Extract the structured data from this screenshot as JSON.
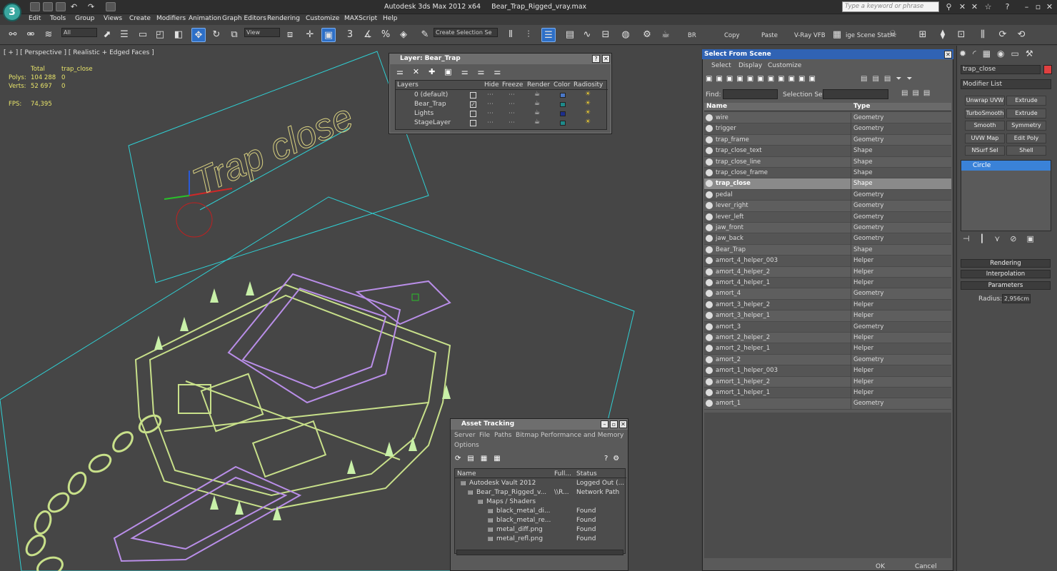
{
  "app": {
    "title": "Autodesk 3ds Max  2012 x64",
    "file": "Bear_Trap_Rigged_vray.max",
    "search_placeholder": "Type a keyword or phrase",
    "logo": "3ds-max-logo"
  },
  "menu": [
    "Edit",
    "Tools",
    "Group",
    "Views",
    "Create",
    "Modifiers",
    "Animation",
    "Graph Editors",
    "Rendering",
    "Customize",
    "MAXScript",
    "Help"
  ],
  "toolbar": {
    "filter": "All",
    "coord": "View",
    "selection_set": "Create Selection Se",
    "br": "BR",
    "copy": "Copy",
    "paste": "Paste",
    "vrayvfb": "V-Ray VFB",
    "scene_state": "ige Scene Stat",
    "snap3": "3",
    "angle_pct": "%"
  },
  "viewport": {
    "label": "[ + ] [ Perspective ] [ Realistic + Edged Faces ]",
    "stats": {
      "col_total": "Total",
      "col_sel": "trap_close",
      "polys_label": "Polys:",
      "polys_total": "104 288",
      "polys_sel": "0",
      "verts_label": "Verts:",
      "verts_total": "52 697",
      "verts_sel": "0",
      "fps_label": "FPS:",
      "fps": "74,395"
    },
    "scene_text": "Trap close"
  },
  "layer_dialog": {
    "title": "Layer: Bear_Trap",
    "columns": [
      "Layers",
      "Hide",
      "Freeze",
      "Render",
      "Color",
      "Radiosity"
    ],
    "rows": [
      {
        "name": "0 (default)",
        "color": "#4a78c8",
        "active": false
      },
      {
        "name": "Bear_Trap",
        "color": "#1e8a8a",
        "active": true
      },
      {
        "name": "Lights",
        "color": "#1c2e8c",
        "active": false
      },
      {
        "name": "StageLayer",
        "color": "#1e8a8a",
        "active": false
      }
    ]
  },
  "select_from_scene": {
    "title": "Select From Scene",
    "menu": [
      "Select",
      "Display",
      "Customize"
    ],
    "find_label": "Find:",
    "selset_label": "Selection Set:",
    "col_name": "Name",
    "col_type": "Type",
    "rows": [
      {
        "name": "wire",
        "type": "Geometry"
      },
      {
        "name": "trigger",
        "type": "Geometry"
      },
      {
        "name": "trap_frame",
        "type": "Geometry"
      },
      {
        "name": "trap_close_text",
        "type": "Shape"
      },
      {
        "name": "trap_close_line",
        "type": "Shape"
      },
      {
        "name": "trap_close_frame",
        "type": "Shape"
      },
      {
        "name": "trap_close",
        "type": "Shape",
        "selected": true
      },
      {
        "name": "pedal",
        "type": "Geometry"
      },
      {
        "name": "lever_right",
        "type": "Geometry"
      },
      {
        "name": "lever_left",
        "type": "Geometry"
      },
      {
        "name": "jaw_front",
        "type": "Geometry"
      },
      {
        "name": "jaw_back",
        "type": "Geometry"
      },
      {
        "name": "Bear_Trap",
        "type": "Shape"
      },
      {
        "name": "amort_4_helper_003",
        "type": "Helper"
      },
      {
        "name": "amort_4_helper_2",
        "type": "Helper"
      },
      {
        "name": "amort_4_helper_1",
        "type": "Helper"
      },
      {
        "name": "amort_4",
        "type": "Geometry"
      },
      {
        "name": "amort_3_helper_2",
        "type": "Helper"
      },
      {
        "name": "amort_3_helper_1",
        "type": "Helper"
      },
      {
        "name": "amort_3",
        "type": "Geometry"
      },
      {
        "name": "amort_2_helper_2",
        "type": "Helper"
      },
      {
        "name": "amort_2_helper_1",
        "type": "Helper"
      },
      {
        "name": "amort_2",
        "type": "Geometry"
      },
      {
        "name": "amort_1_helper_003",
        "type": "Helper"
      },
      {
        "name": "amort_1_helper_2",
        "type": "Helper"
      },
      {
        "name": "amort_1_helper_1",
        "type": "Helper"
      },
      {
        "name": "amort_1",
        "type": "Geometry"
      }
    ],
    "ok": "OK",
    "cancel": "Cancel"
  },
  "command_panel": {
    "object_name": "trap_close",
    "modifier_list": "Modifier List",
    "buttons": [
      "Unwrap UVW",
      "Extrude",
      "TurboSmooth",
      "Extrude",
      "Smooth",
      "Symmetry",
      "UVW Map",
      "Edit Poly",
      "NSurf Sel",
      "Shell"
    ],
    "stack_item": "Circle",
    "rollouts": [
      "Rendering",
      "Interpolation",
      "Parameters"
    ],
    "radius_label": "Radius:",
    "radius_value": "2,956cm",
    "object_color": "#e04040"
  },
  "asset_tracking": {
    "title": "Asset Tracking",
    "menu": [
      "Server",
      "File",
      "Paths",
      "Bitmap Performance and Memory",
      "Options"
    ],
    "columns": [
      "Name",
      "Full...",
      "Status"
    ],
    "rows": [
      {
        "name": "Autodesk Vault 2012",
        "full": "",
        "status": "Logged Out (..."
      },
      {
        "name": "Bear_Trap_Rigged_v...",
        "full": "\\\\R...",
        "status": "Network Path"
      },
      {
        "name": "Maps / Shaders",
        "full": "",
        "status": ""
      },
      {
        "name": "black_metal_di...",
        "full": "",
        "status": "Found"
      },
      {
        "name": "black_metal_re...",
        "full": "",
        "status": "Found"
      },
      {
        "name": "metal_diff.png",
        "full": "",
        "status": "Found"
      },
      {
        "name": "metal_refl.png",
        "full": "",
        "status": "Found"
      }
    ]
  }
}
